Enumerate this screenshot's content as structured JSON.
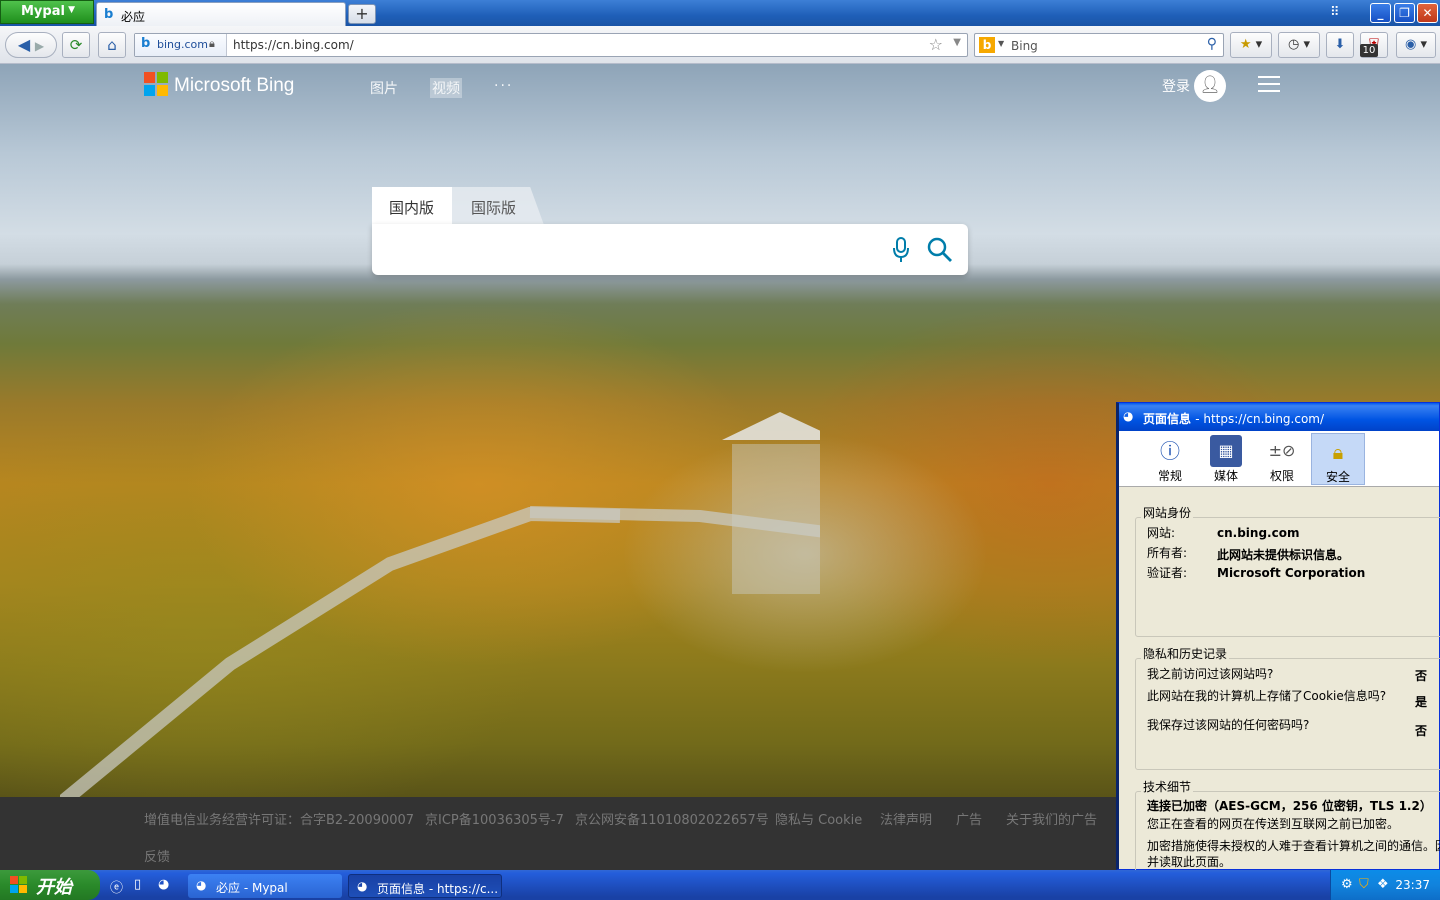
{
  "browser": {
    "app_menu": "Mypal",
    "tab_title": "必应",
    "new_tab": "+",
    "window_buttons": [
      "_",
      "❐",
      "✕"
    ],
    "identity_label": "bing.com",
    "url": "https://cn.bing.com/",
    "search_placeholder": "Bing",
    "badge_count": "10"
  },
  "bing": {
    "logo_text": "Microsoft Bing",
    "nav": [
      "图片",
      "视频",
      "···"
    ],
    "signin": "登录",
    "scope_tabs": [
      "国内版",
      "国际版"
    ]
  },
  "footer": {
    "links": [
      "增值电信业务经营许可证：合字B2-20090007",
      "京ICP备10036305号-7",
      "京公网安备11010802022657号",
      "隐私与 Cookie",
      "法律声明",
      "广告",
      "关于我们的广告"
    ],
    "feedback": "反馈"
  },
  "dialog": {
    "title": "页面信息",
    "title_url": "- https://cn.bing.com/",
    "tabs": [
      "常规",
      "媒体",
      "权限",
      "安全"
    ],
    "identity": {
      "heading": "网站身份",
      "rows": [
        {
          "label": "网站:",
          "value": "cn.bing.com"
        },
        {
          "label": "所有者:",
          "value": "此网站未提供标识信息。"
        },
        {
          "label": "验证者:",
          "value": "Microsoft Corporation"
        }
      ]
    },
    "privacy": {
      "heading": "隐私和历史记录",
      "rows": [
        {
          "q": "我之前访问过该网站吗?",
          "a": "否"
        },
        {
          "q": "此网站在我的计算机上存储了Cookie信息吗?",
          "a": "是"
        },
        {
          "q": "我保存过该网站的任何密码吗?",
          "a": "否"
        }
      ]
    },
    "tech": {
      "heading": "技术细节",
      "bold": "连接已加密（AES-GCM，256 位密钥，TLS 1.2）",
      "line1": "您正在查看的网页在传送到互联网之前已加密。",
      "line2": "加密措施使得未授权的人难于查看计算机之间的通信。因",
      "line3": "并读取此页面。"
    }
  },
  "taskbar": {
    "start": "开始",
    "tasks": [
      "必应 - Mypal",
      "页面信息 - https://c..."
    ],
    "clock": "23:37"
  },
  "colors": {
    "xp_blue": "#245edb",
    "start_green": "#2a8a2a",
    "bing_accent": "#007daa"
  }
}
